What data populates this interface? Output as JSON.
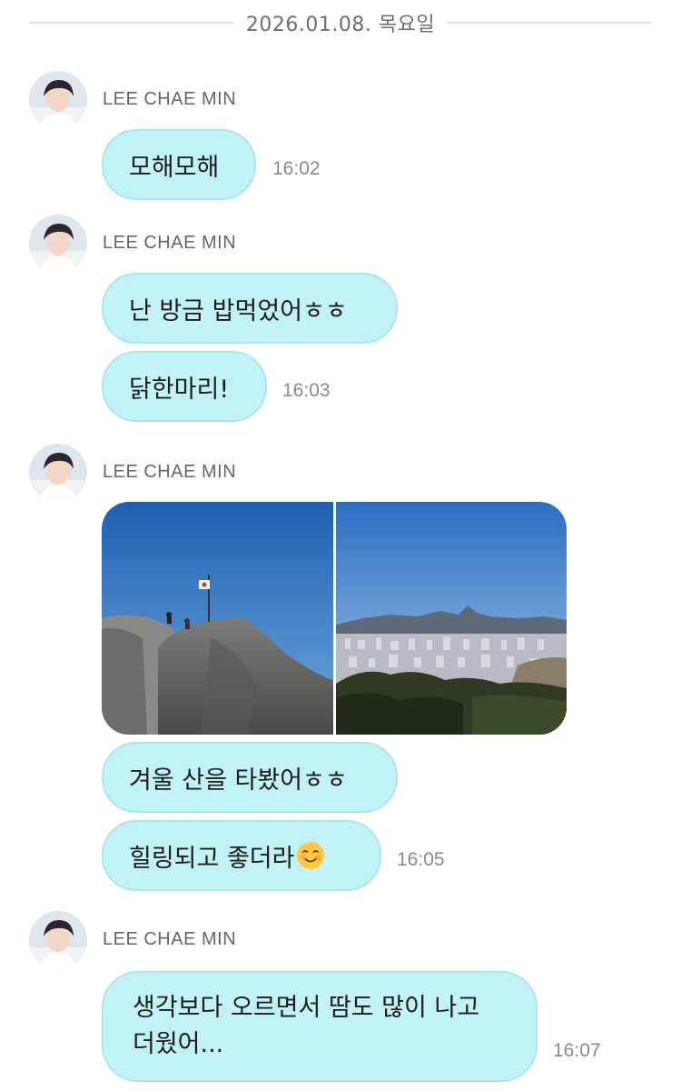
{
  "date_separator": "2026.01.08. 목요일",
  "groups": [
    {
      "sender": "LEE CHAE MIN",
      "messages": [
        {
          "text": "모해모해",
          "time": "16:02"
        }
      ]
    },
    {
      "sender": "LEE CHAE MIN",
      "messages": [
        {
          "text": "난 방금 밥먹었어ㅎㅎ",
          "time": ""
        },
        {
          "text": "닭한마리!",
          "time": "16:03"
        }
      ]
    },
    {
      "sender": "LEE CHAE MIN",
      "photos": [
        {
          "icon": "mountain-peak-flag-photo"
        },
        {
          "icon": "city-view-photo"
        }
      ],
      "messages": [
        {
          "text": "겨울 산을 타봤어ㅎㅎ",
          "time": ""
        },
        {
          "text": "힐링되고 좋더라",
          "emoji": "smiling-face-emoji",
          "time": "16:05"
        }
      ]
    },
    {
      "sender": "LEE CHAE MIN",
      "messages": [
        {
          "lines": [
            "생각보다 오르면서 땀도 많이 나고",
            "더웠어..."
          ],
          "time": "16:07"
        }
      ]
    }
  ],
  "colors": {
    "bubble": "#c1f3f6",
    "bubble_border": "#a9e6ec",
    "time": "#8a8a8a",
    "sender": "#666666"
  }
}
